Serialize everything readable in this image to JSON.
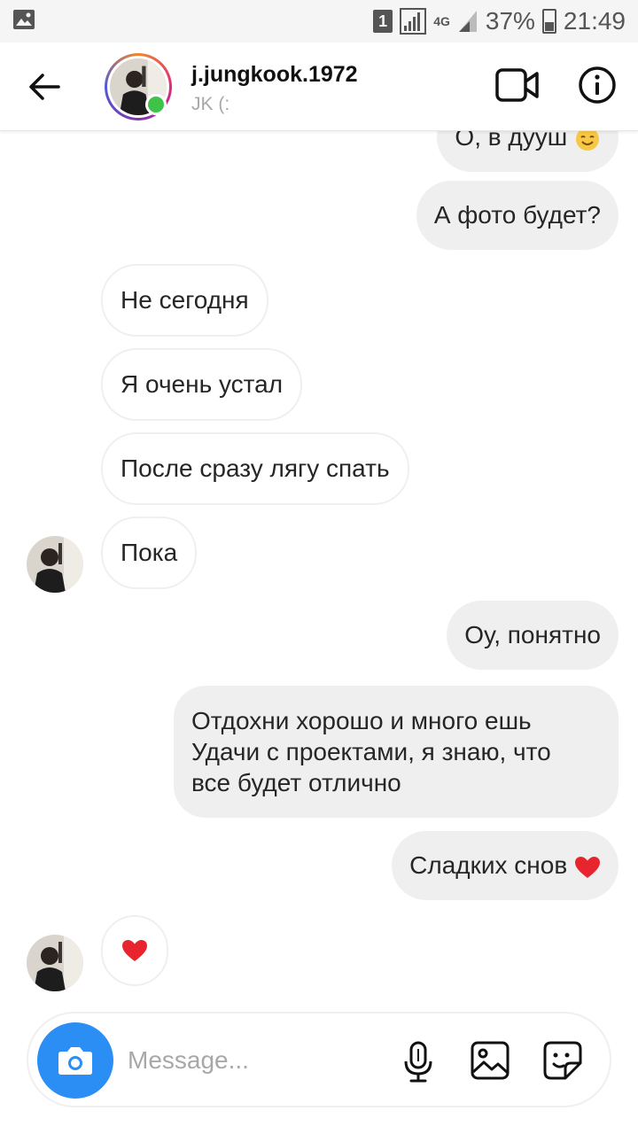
{
  "status_bar": {
    "sim_slot": "1",
    "network_type": "4G",
    "battery": "37%",
    "time": "21:49"
  },
  "header": {
    "username": "j.jungkook.1972",
    "subtitle": "JK (:",
    "online": true
  },
  "messages": [
    {
      "side": "out",
      "text": "О, в дууш",
      "emoji": "smiling-face"
    },
    {
      "side": "out",
      "text": "А фото будет?"
    },
    {
      "side": "in",
      "text": "Не сегодня"
    },
    {
      "side": "in",
      "text": "Я очень устал"
    },
    {
      "side": "in",
      "text": "После сразу лягу спать"
    },
    {
      "side": "in",
      "text": "Пока",
      "show_avatar": true
    },
    {
      "side": "out",
      "text": "Оу, понятно"
    },
    {
      "side": "out",
      "lines": [
        "Отдохни хорошо и много ешь",
        "Удачи с проектами, я знаю, что",
        "все будет отлично"
      ]
    },
    {
      "side": "out",
      "text": "Сладких снов",
      "emoji": "red-heart"
    },
    {
      "side": "in",
      "text": "",
      "emoji": "red-heart",
      "show_avatar": true
    }
  ],
  "composer": {
    "placeholder": "Message..."
  },
  "colors": {
    "online": "#3ec348",
    "camera_button": "#2b8ef5",
    "outgoing_bubble": "#efefef",
    "heart": "#e8252f"
  }
}
